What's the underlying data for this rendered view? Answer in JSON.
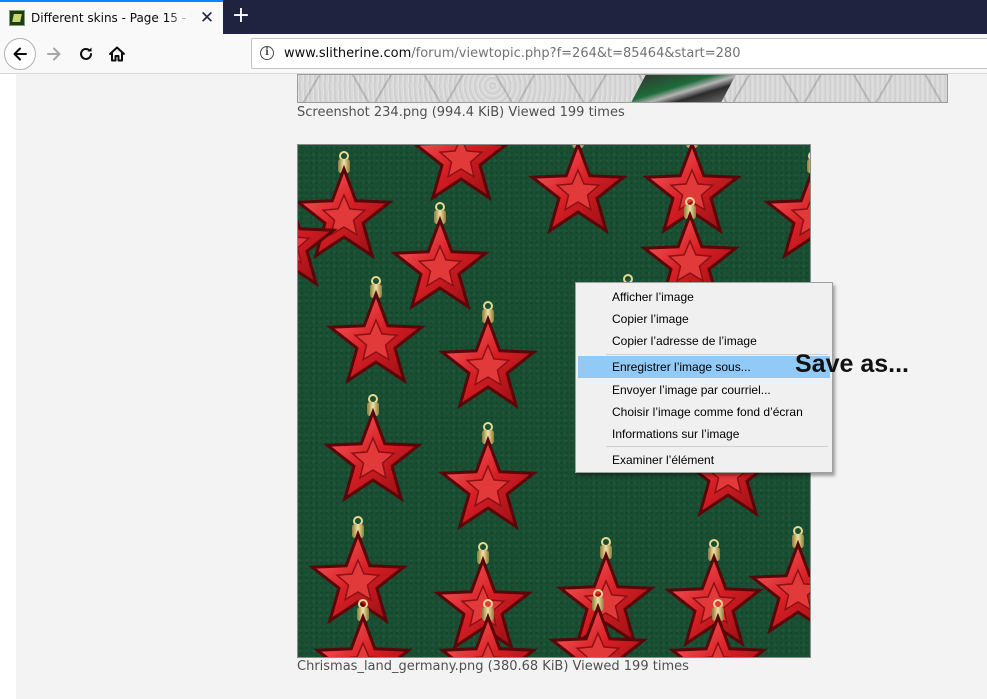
{
  "browser": {
    "tab_title": "Different skins - Page 15 - Slitherine",
    "tab_close": "✕",
    "new_tab": "+",
    "url_domain": "www.slitherine.com",
    "url_path": "/forum/viewtopic.php?f=264&t=85464&start=280",
    "accent_color": "#0a84ff"
  },
  "page": {
    "image1_caption": "Screenshot 234.png (994.4 KiB) Viewed 199 times",
    "image2_caption": "Chrismas_land_germany.png (380.68 KiB) Viewed 199 times"
  },
  "context_menu": {
    "items": [
      "Afficher l’image",
      "Copier l’image",
      "Copier l’adresse de l’image",
      "Enregistrer l’image sous...",
      "Envoyer l’image par courriel...",
      "Choisir l’image comme fond d’écran",
      "Informations sur l’image",
      "Examiner l’élément"
    ],
    "highlighted_item": "Enregistrer l’image sous...",
    "highlight_color": "#91c9f7"
  },
  "annotation": {
    "text": "Save as..."
  },
  "icons": [
    "back-arrow-icon",
    "forward-arrow-icon",
    "reload-icon",
    "home-icon",
    "info-icon",
    "close-icon",
    "plus-icon",
    "site-favicon"
  ]
}
